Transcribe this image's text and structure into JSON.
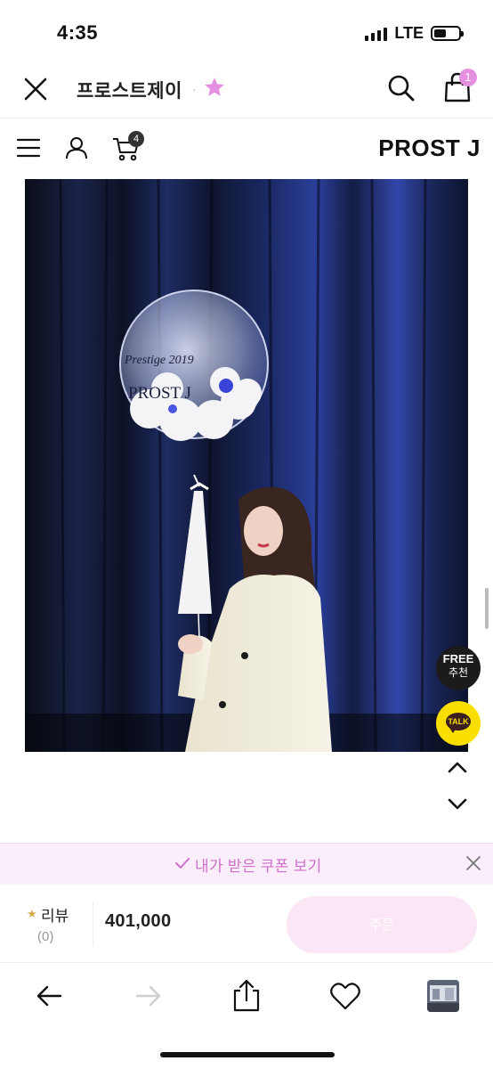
{
  "status_bar": {
    "time": "4:35",
    "network": "LTE"
  },
  "header": {
    "store_name": "프로스트제이",
    "separator": "·",
    "cart_badge": "1"
  },
  "shop_nav": {
    "cart_count": "4",
    "brand": "PROST J"
  },
  "product_image": {
    "balloon_text_line1": "Prestige 2019",
    "balloon_text_line2": "PROST J"
  },
  "floating": {
    "free_label": "FREE",
    "recommend_label": "추천",
    "talk_label": "TALK"
  },
  "coupon": {
    "label": "내가 받은 쿠폰 보기"
  },
  "purchase": {
    "review_label": "리뷰",
    "review_count": "(0)",
    "price": "401,000",
    "buy_label": "주문"
  },
  "colors": {
    "accent_pink": "#e58fe0",
    "coupon_bg": "#fbeefb",
    "coupon_text": "#d06fcb",
    "buy_button": "#fbe6f5",
    "kakao_yellow": "#f9df00"
  },
  "icons": [
    "close-icon",
    "star-icon",
    "search-icon",
    "shopping-bag-icon",
    "menu-icon",
    "user-icon",
    "cart-icon",
    "chevron-up-icon",
    "chevron-down-icon",
    "check-icon",
    "x-icon",
    "arrow-left-icon",
    "arrow-right-icon",
    "share-icon",
    "heart-icon"
  ]
}
